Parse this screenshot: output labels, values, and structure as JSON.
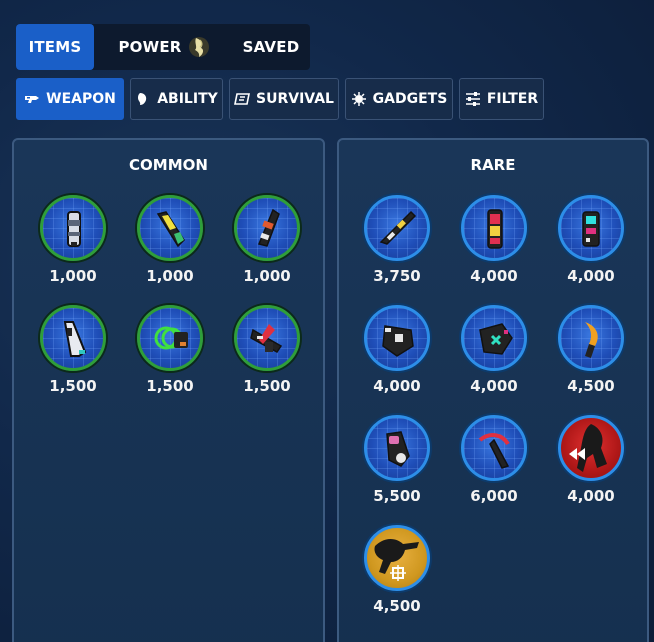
{
  "top_tabs": {
    "items": "ITEMS",
    "power": "POWER",
    "saved": "SAVED"
  },
  "filters": [
    {
      "label": "WEAPON",
      "icon": "weapon-icon",
      "active": true
    },
    {
      "label": "ABILITY",
      "icon": "ability-icon",
      "active": false
    },
    {
      "label": "SURVIVAL",
      "icon": "survival-icon",
      "active": false
    },
    {
      "label": "GADGETS",
      "icon": "gadgets-icon",
      "active": false
    },
    {
      "label": "FILTER",
      "icon": "sliders-icon",
      "active": false
    }
  ],
  "panels": {
    "common": {
      "title": "COMMON",
      "items": [
        {
          "price": "1,000"
        },
        {
          "price": "1,000"
        },
        {
          "price": "1,000"
        },
        {
          "price": "1,500"
        },
        {
          "price": "1,500"
        },
        {
          "price": "1,500"
        }
      ]
    },
    "rare": {
      "title": "RARE",
      "items": [
        {
          "price": "3,750"
        },
        {
          "price": "4,000"
        },
        {
          "price": "4,000"
        },
        {
          "price": "4,000"
        },
        {
          "price": "4,000"
        },
        {
          "price": "4,500"
        },
        {
          "price": "5,500"
        },
        {
          "price": "6,000"
        },
        {
          "price": "4,000"
        },
        {
          "price": "4,500"
        }
      ]
    }
  },
  "colors": {
    "accent": "#1a5fc8",
    "common_ring": "#2f9e3a",
    "rare_ring": "#2d8ee8"
  }
}
